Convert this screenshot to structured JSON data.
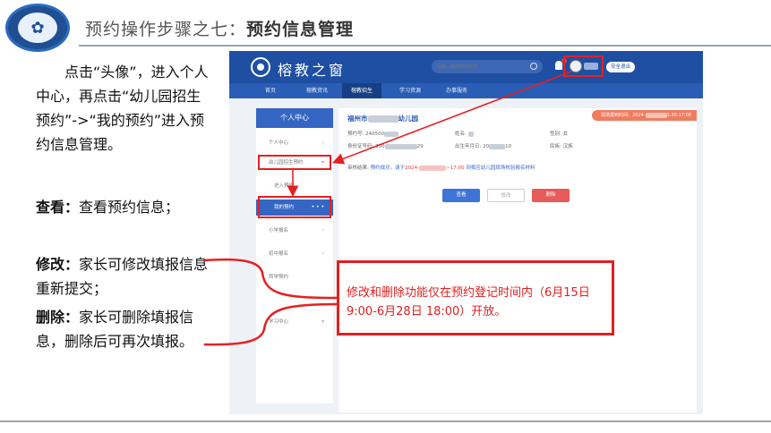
{
  "slide": {
    "title_prefix": "预约操作步骤之七：",
    "title_bold": "预约信息管理"
  },
  "instructions": {
    "intro": "点击“头像”，进入个人中心，再点击“幼儿园招生预约”->“我的预约”进入预约信息管理。",
    "view_label": "查看：",
    "view_text": "查看预约信息；",
    "edit_label": "修改：",
    "edit_text": "家长可修改填报信息重新提交；",
    "delete_label": "删除：",
    "delete_text": "家长可删除填报信息，删除后可再次填报。"
  },
  "callout": {
    "text": "修改和删除功能仅在预约登记时间内（6月15日 9:00-6月28日 18:00）开放。"
  },
  "site": {
    "name": "榕教之窗",
    "search_placeholder": "请输入要搜索的内容",
    "logout_label": "安全退出",
    "nav": [
      "首页",
      "榕教资讯",
      "榕教招生",
      "学习资源",
      "办事服务"
    ]
  },
  "sidebar": {
    "header": "个人中心",
    "items": [
      {
        "label": "个人中心",
        "chev": "›"
      },
      {
        "label": "幼儿园招生预约",
        "chev": "▾"
      },
      {
        "label": "进入预约",
        "chev": ""
      },
      {
        "label": "我的预约",
        "chev": "• • •"
      },
      {
        "label": "小学报名",
        "chev": "›"
      },
      {
        "label": "初中报名",
        "chev": "›"
      },
      {
        "label": "转学预约",
        "chev": ""
      },
      {
        "label": "学习中心",
        "chev": "▾"
      }
    ]
  },
  "record": {
    "school": "福州市",
    "school_suffix": "幼儿园",
    "time_tag": "现场报到时间：2024-",
    "time_tag_end": "3:30-17:00",
    "booking_no_label": "预约号: 240500",
    "name_label": "姓名:",
    "gender": "性别: 女",
    "id_label": "身份证号码: 350",
    "id_end": "29",
    "birth_label": "出生年月日: 20",
    "birth_end": "10",
    "ethnicity": "民族: 汉族",
    "audit_label": "审核结果:",
    "audit_link": "预约成功，请于",
    "audit_date_start": "2024-",
    "audit_date_end": "~17:00",
    "audit_tail": "到相应幼儿园现场核验报名材料",
    "btn_view": "查看",
    "btn_edit": "修改",
    "btn_delete": "删除"
  },
  "colors": {
    "header_blue": "#1e4fa3",
    "nav_blue": "#2a5db5",
    "active_blue": "#3566c4",
    "annotation_red": "#e62020"
  }
}
